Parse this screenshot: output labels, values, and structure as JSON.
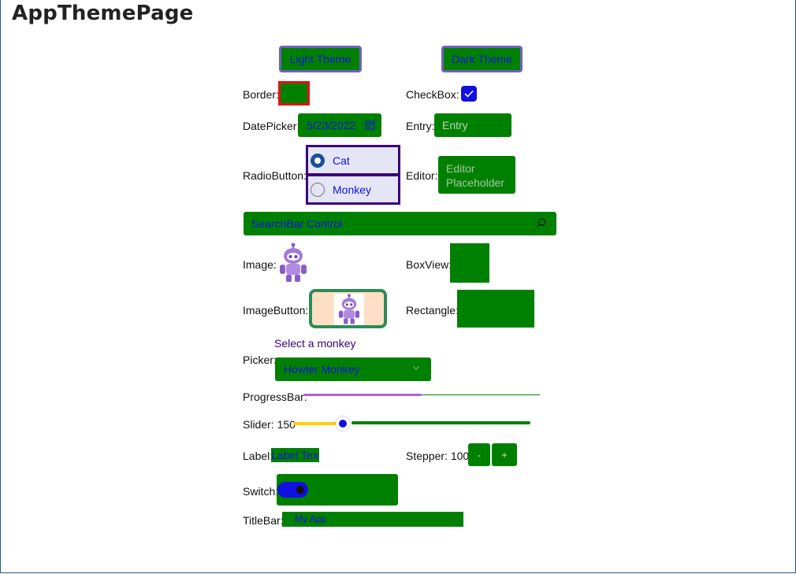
{
  "page": {
    "title": "AppThemePage"
  },
  "theme_buttons": {
    "light": "Light Theme",
    "dark": "Dark Theme"
  },
  "labels": {
    "border": "Border:",
    "checkbox": "CheckBox:",
    "datepicker": "DatePicker:",
    "entry": "Entry:",
    "radiobutton": "RadioButton:",
    "editor": "Editor:",
    "image": "Image:",
    "boxview": "BoxView:",
    "imagebutton": "ImageButton:",
    "rectangle": "Rectangle:",
    "picker": "Picker:",
    "progressbar": "ProgressBar:",
    "slider": "Slider: 150",
    "label": "Label:",
    "stepper": "Stepper: 100",
    "switch": "Switch:",
    "titlebar": "TitleBar:"
  },
  "checkbox": {
    "checked": true
  },
  "datepicker": {
    "value": "5/23/2022"
  },
  "entry": {
    "placeholder": "Entry"
  },
  "radio": {
    "options": [
      "Cat",
      "Monkey"
    ],
    "selected": "Cat"
  },
  "editor": {
    "placeholder": "Editor Placeholder"
  },
  "searchbar": {
    "placeholder": "SearchBar Control"
  },
  "picker": {
    "title": "Select a monkey",
    "selected": "Howler Monkey"
  },
  "progressbar": {
    "progress": 0.5
  },
  "slider": {
    "value": 150,
    "fraction": 0.2
  },
  "label_control": {
    "text": "Label Text"
  },
  "stepper": {
    "minus": "-",
    "plus": "+"
  },
  "switch": {
    "on": true
  },
  "titlebar": {
    "text": "My App"
  },
  "colors": {
    "accent_green": "#008000",
    "text_blue": "#1010e0",
    "border_red": "#e81010",
    "radio_purple": "#3a0080",
    "progress_purple": "#b060e0",
    "slider_yellow": "#ffd000"
  }
}
